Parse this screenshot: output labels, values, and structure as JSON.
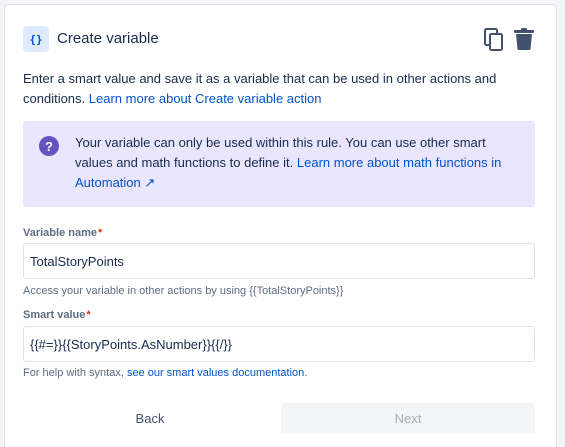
{
  "header": {
    "icon_text": "{}",
    "title": "Create variable"
  },
  "description": {
    "text": "Enter a smart value and save it as a variable that can be used in other actions and conditions.",
    "link": "Learn more about Create variable action"
  },
  "info": {
    "text": "Your variable can only be used within this rule. You can use other smart values and math functions to define it.",
    "link": "Learn more about math functions in Automation ↗"
  },
  "variable_name": {
    "label": "Variable name",
    "required_mark": "*",
    "value": "TotalStoryPoints",
    "help": "Access your variable in other actions by using {{TotalStoryPoints}}"
  },
  "smart_value": {
    "label": "Smart value",
    "required_mark": "*",
    "value": "{{#=}}{{StoryPoints.AsNumber}}{{/}}",
    "help_prefix": "For help with syntax,",
    "help_link": "see our smart values documentation",
    "help_suffix": "."
  },
  "buttons": {
    "back": "Back",
    "next": "Next"
  },
  "colors": {
    "accent": "#0052cc",
    "info_bg": "#eae6ff",
    "info_icon": "#6554c0",
    "required": "#de350b"
  },
  "icons": [
    "variable-icon",
    "copy-icon",
    "trash-icon",
    "question-icon"
  ]
}
